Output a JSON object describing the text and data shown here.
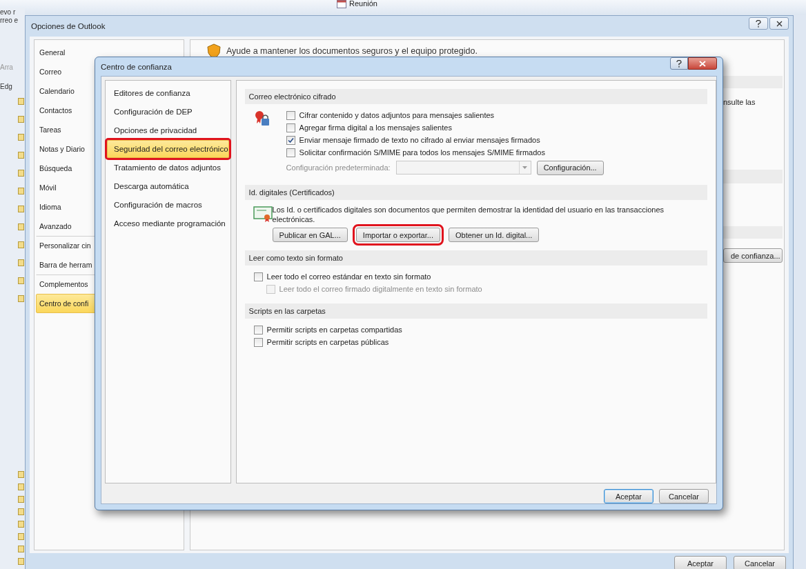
{
  "background_window": {
    "ribbon_label": "Reunión",
    "side_texts": [
      "evo r",
      "rreo e",
      "Arra",
      "Edg"
    ]
  },
  "options_window": {
    "title": "Opciones de Outlook",
    "nav": [
      {
        "label": "General",
        "selected": false,
        "separator_before": false
      },
      {
        "label": "Correo",
        "selected": false,
        "separator_before": false
      },
      {
        "label": "Calendario",
        "selected": false,
        "separator_before": false
      },
      {
        "label": "Contactos",
        "selected": false,
        "separator_before": false
      },
      {
        "label": "Tareas",
        "selected": false,
        "separator_before": false
      },
      {
        "label": "Notas y Diario",
        "selected": false,
        "separator_before": false
      },
      {
        "label": "Búsqueda",
        "selected": false,
        "separator_before": false
      },
      {
        "label": "Móvil",
        "selected": false,
        "separator_before": false
      },
      {
        "label": "Idioma",
        "selected": false,
        "separator_before": false
      },
      {
        "label": "Avanzado",
        "selected": false,
        "separator_before": false
      },
      {
        "label": "Personalizar cin",
        "selected": false,
        "separator_before": true
      },
      {
        "label": "Barra de herram",
        "selected": false,
        "separator_before": false
      },
      {
        "label": "Complementos",
        "selected": false,
        "separator_before": true
      },
      {
        "label": "Centro de confi",
        "selected": true,
        "separator_before": false
      }
    ],
    "heading": "Ayude a mantener los documentos seguros y el equipo protegido.",
    "fragment": "nsulte las",
    "fragment_button": "de confianza...",
    "buttons": [
      "Aceptar",
      "Cancelar"
    ]
  },
  "dialog": {
    "title": "Centro de confianza",
    "nav": [
      {
        "label": "Editores de confianza",
        "selected": false,
        "outlined": false
      },
      {
        "label": "Configuración de DEP",
        "selected": false,
        "outlined": false
      },
      {
        "label": "Opciones de privacidad",
        "selected": false,
        "outlined": false
      },
      {
        "label": "Seguridad del correo electrónico",
        "selected": true,
        "outlined": true
      },
      {
        "label": "Tratamiento de datos adjuntos",
        "selected": false,
        "outlined": false
      },
      {
        "label": "Descarga automática",
        "selected": false,
        "outlined": false
      },
      {
        "label": "Configuración de macros",
        "selected": false,
        "outlined": false
      },
      {
        "label": "Acceso mediante programación",
        "selected": false,
        "outlined": false
      }
    ],
    "sections": [
      {
        "title": "Correo electrónico cifrado",
        "items": [
          {
            "kind": "checkbox",
            "label": "Cifrar contenido y datos adjuntos para mensajes salientes",
            "checked": false,
            "disabled": false
          },
          {
            "kind": "checkbox",
            "label": "Agregar firma digital a los mensajes salientes",
            "checked": false,
            "disabled": false
          },
          {
            "kind": "checkbox",
            "label": "Enviar mensaje firmado de texto no cifrado al enviar mensajes firmados",
            "checked": true,
            "disabled": false
          },
          {
            "kind": "checkbox",
            "label": "Solicitar confirmación S/MIME para todos los mensajes S/MIME firmados",
            "checked": false,
            "disabled": false
          },
          {
            "kind": "select",
            "label": "Configuración predeterminada:",
            "disabled": true,
            "button": "Configuración..."
          }
        ]
      },
      {
        "title": "Id. digitales (Certificados)",
        "items": [
          {
            "kind": "text",
            "text": "Los Id. o certificados digitales son documentos que permiten demostrar la identidad del usuario en las transacciones electrónicas."
          },
          {
            "kind": "buttons",
            "buttons": [
              {
                "label": "Publicar en GAL...",
                "outlined": false
              },
              {
                "label": "Importar o exportar...",
                "outlined": true
              },
              {
                "label": "Obtener un Id. digital...",
                "outlined": false
              }
            ]
          }
        ]
      },
      {
        "title": "Leer como texto sin formato",
        "items": [
          {
            "kind": "checkbox",
            "label": "Leer todo el correo estándar en texto sin formato",
            "checked": false,
            "disabled": false,
            "children": [
              {
                "kind": "checkbox",
                "label": "Leer todo el correo firmado digitalmente en texto sin formato",
                "checked": false,
                "disabled": true
              }
            ]
          }
        ]
      },
      {
        "title": "Scripts en las carpetas",
        "items": [
          {
            "kind": "checkbox",
            "label": "Permitir scripts en carpetas compartidas",
            "checked": false,
            "disabled": false
          },
          {
            "kind": "checkbox",
            "label": "Permitir scripts en carpetas públicas",
            "checked": false,
            "disabled": false
          }
        ]
      }
    ],
    "buttons": [
      {
        "label": "Aceptar",
        "default": true
      },
      {
        "label": "Cancelar",
        "default": false
      }
    ]
  }
}
